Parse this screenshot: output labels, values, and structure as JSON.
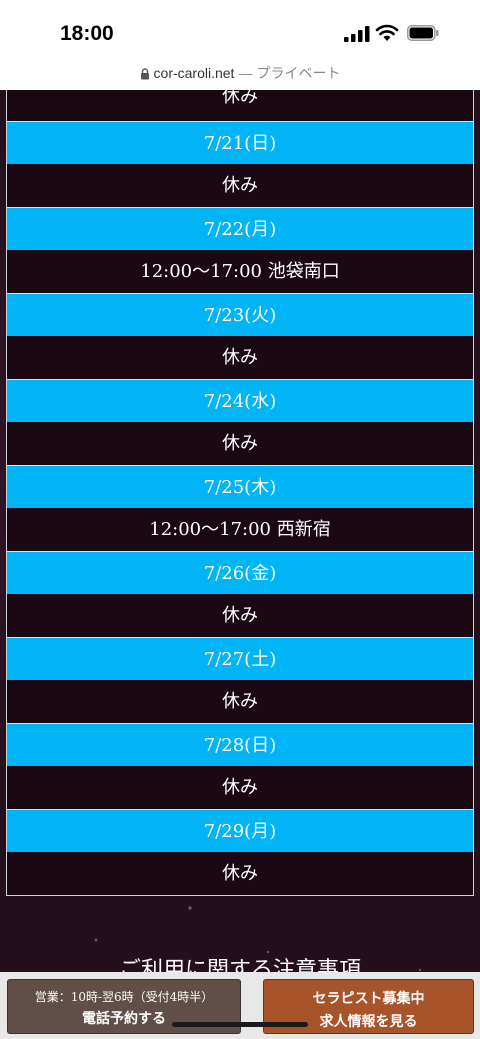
{
  "status_bar": {
    "time": "18:00"
  },
  "url_bar": {
    "domain": "cor-caroli.net",
    "separator": "—",
    "privacy": "プライベート"
  },
  "schedule": {
    "top_partial": "休み",
    "days": [
      {
        "date": "7/21(日)",
        "status": "休み"
      },
      {
        "date": "7/22(月)",
        "status": "12:00〜17:00  池袋南口"
      },
      {
        "date": "7/23(火)",
        "status": "休み"
      },
      {
        "date": "7/24(水)",
        "status": "休み"
      },
      {
        "date": "7/25(木)",
        "status": "12:00〜17:00  西新宿"
      },
      {
        "date": "7/26(金)",
        "status": "休み"
      },
      {
        "date": "7/27(土)",
        "status": "休み"
      },
      {
        "date": "7/28(日)",
        "status": "休み"
      },
      {
        "date": "7/29(月)",
        "status": "休み"
      }
    ]
  },
  "notice": {
    "heading": "ご利用に関する注意事項"
  },
  "bottom_bar": {
    "phone": {
      "hours": "営業：10時-翌6時（受付4時半）",
      "label": "電話予約する"
    },
    "recruit": {
      "line1": "セラピスト募集中",
      "line2": "求人情報を見る"
    }
  },
  "colors": {
    "date_header": "#00b4f6",
    "row_bg": "#1a0812",
    "phone_button": "#5f4f48",
    "recruit_button": "#a8542a"
  }
}
